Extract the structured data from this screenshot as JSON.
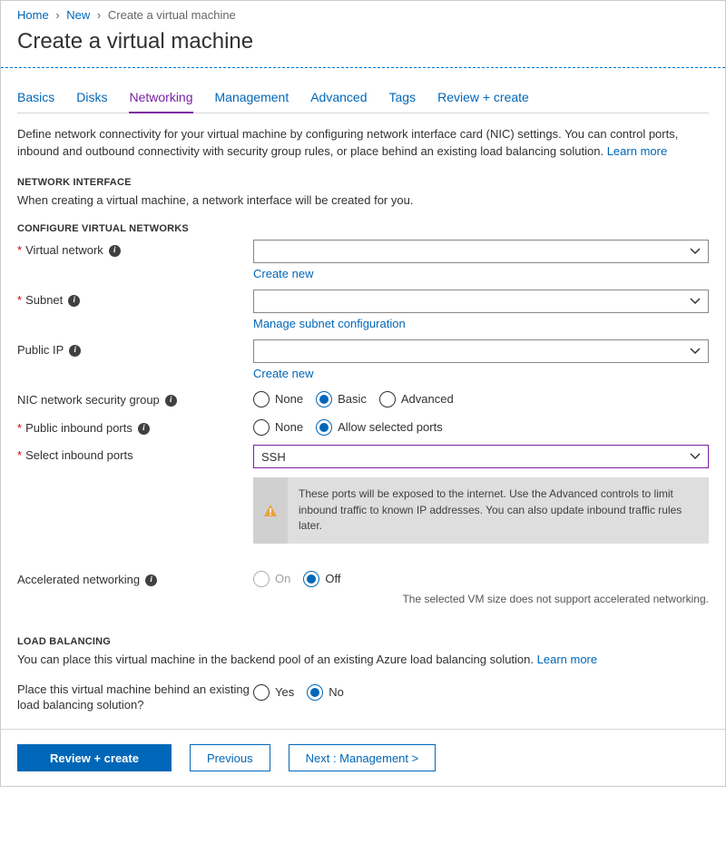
{
  "breadcrumb": {
    "home": "Home",
    "new": "New",
    "current": "Create a virtual machine"
  },
  "title": "Create a virtual machine",
  "tabs": [
    "Basics",
    "Disks",
    "Networking",
    "Management",
    "Advanced",
    "Tags",
    "Review + create"
  ],
  "activeTab": "Networking",
  "intro": {
    "text": "Define network connectivity for your virtual machine by configuring network interface card (NIC) settings. You can control ports, inbound and outbound connectivity with security group rules, or place behind an existing load balancing solution.  ",
    "learn": "Learn more"
  },
  "sections": {
    "networkInterface": {
      "header": "NETWORK INTERFACE",
      "note": "When creating a virtual machine, a network interface will be created for you."
    },
    "configure": {
      "header": "CONFIGURE VIRTUAL NETWORKS",
      "virtualNetwork": {
        "label": "Virtual network",
        "createNew": "Create new"
      },
      "subnet": {
        "label": "Subnet",
        "manage": "Manage subnet configuration"
      },
      "publicIp": {
        "label": "Public IP",
        "createNew": "Create new"
      },
      "nsg": {
        "label": "NIC network security group",
        "options": {
          "none": "None",
          "basic": "Basic",
          "advanced": "Advanced"
        }
      },
      "inboundPorts": {
        "label": "Public inbound ports",
        "options": {
          "none": "None",
          "allow": "Allow selected ports"
        }
      },
      "selectPorts": {
        "label": "Select inbound ports",
        "value": "SSH"
      },
      "warning": "These ports will be exposed to the internet. Use the Advanced controls to limit inbound traffic to known IP addresses. You can also update inbound traffic rules later.",
      "accel": {
        "label": "Accelerated networking",
        "options": {
          "on": "On",
          "off": "Off"
        },
        "note": "The selected VM size does not support accelerated networking."
      }
    },
    "loadBalancing": {
      "header": "LOAD BALANCING",
      "note": "You can place this virtual machine in the backend pool of an existing Azure load balancing solution.  ",
      "learn": "Learn more",
      "placeBehind": {
        "label": "Place this virtual machine behind an existing load balancing solution?",
        "options": {
          "yes": "Yes",
          "no": "No"
        }
      }
    }
  },
  "footer": {
    "review": "Review + create",
    "previous": "Previous",
    "next": "Next : Management >"
  }
}
